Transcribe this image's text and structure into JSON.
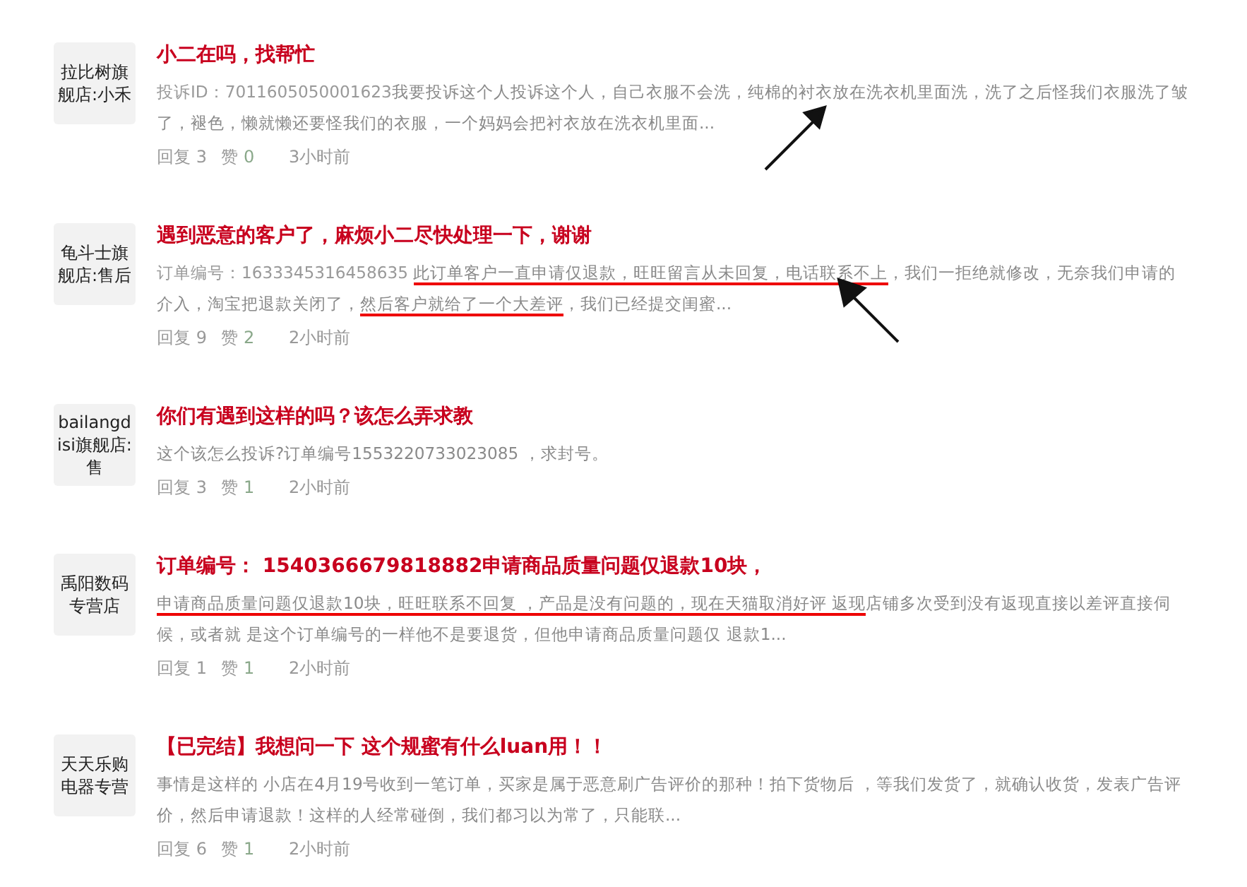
{
  "posts": [
    {
      "shop": "拉比树旗舰店:小禾",
      "title": "小二在吗，找帮忙",
      "body": [
        {
          "text": "投诉ID：7011605050001623",
          "marked": false,
          "kind": "id"
        },
        {
          "text": "我要投诉这个人投诉这个人，自己衣服不会洗，纯棉的衬衣放在洗衣机里面洗，洗了之后怪我们衣服洗了皱了，褪色，懒就懒还要怪我们的衣服，一个妈妈会把衬衣放在洗衣机里面...",
          "marked": false,
          "kind": "text"
        }
      ],
      "replies": "回复 3",
      "likes": "赞",
      "like_count": "0",
      "time": "3小时前",
      "arrow": true
    },
    {
      "shop": "龟斗士旗舰店:售后",
      "title": "遇到恶意的客户了，麻烦小二尽快处理一下，谢谢",
      "body": [
        {
          "text": "订单编号：1633345316458635 ",
          "marked": false,
          "kind": "id"
        },
        {
          "text": "此订单客户一直申请仅退款，旺旺留言从未回复，电话联系不上",
          "marked": true,
          "kind": "text"
        },
        {
          "text": "，我们一拒绝就修改，无奈我们申请的介入，淘宝把退款关闭了，",
          "marked": false,
          "kind": "text"
        },
        {
          "text": "然后客户就给了一个大差评",
          "marked": true,
          "kind": "text"
        },
        {
          "text": "，我们已经提交闺蜜...",
          "marked": false,
          "kind": "text"
        }
      ],
      "replies": "回复 9",
      "likes": "赞",
      "like_count": "2",
      "time": "2小时前",
      "arrow": true
    },
    {
      "shop": "bailangdisi旗舰店:售",
      "title": "你们有遇到这样的吗？该怎么弄求教",
      "body": [
        {
          "text": " 这个该怎么投诉?订单编号1553220733023085 ，求封号。",
          "marked": false,
          "kind": "text"
        }
      ],
      "replies": "回复 3",
      "likes": "赞",
      "like_count": "1",
      "time": "2小时前",
      "arrow": false
    },
    {
      "shop": "禹阳数码专营店",
      "title": "订单编号： 1540366679818882申请商品质量问题仅退款10块，",
      "body": [
        {
          "text": "申请商品质量问题仅退款10块，旺旺联系不回复 ，产品是没有问题的，现在天猫取消好评 返现",
          "marked": true,
          "kind": "text"
        },
        {
          "text": "店铺多次受到没有返现直接以差评直接伺候，或者就 是这个订单编号的一样他不是要退货，但他申请商品质量问题仅 退款1...",
          "marked": false,
          "kind": "text"
        }
      ],
      "replies": "回复 1",
      "likes": "赞",
      "like_count": "1",
      "time": "2小时前",
      "arrow": false
    },
    {
      "shop": "天天乐购电器专营",
      "title": "【已完结】我想问一下 这个规蜜有什么luan用！！",
      "body": [
        {
          "text": "事情是这样的 小店在4月19号收到一笔订单，买家是属于恶意刷广告评价的那种！拍下货物后 ，等我们发货了，就确认收货，发表广告评价，然后申请退款！这样的人经常碰倒，我们都习以为常了，只能联...",
          "marked": false,
          "kind": "text"
        }
      ],
      "replies": "回复 6",
      "likes": "赞",
      "like_count": "1",
      "time": "2小时前",
      "arrow": false
    }
  ]
}
